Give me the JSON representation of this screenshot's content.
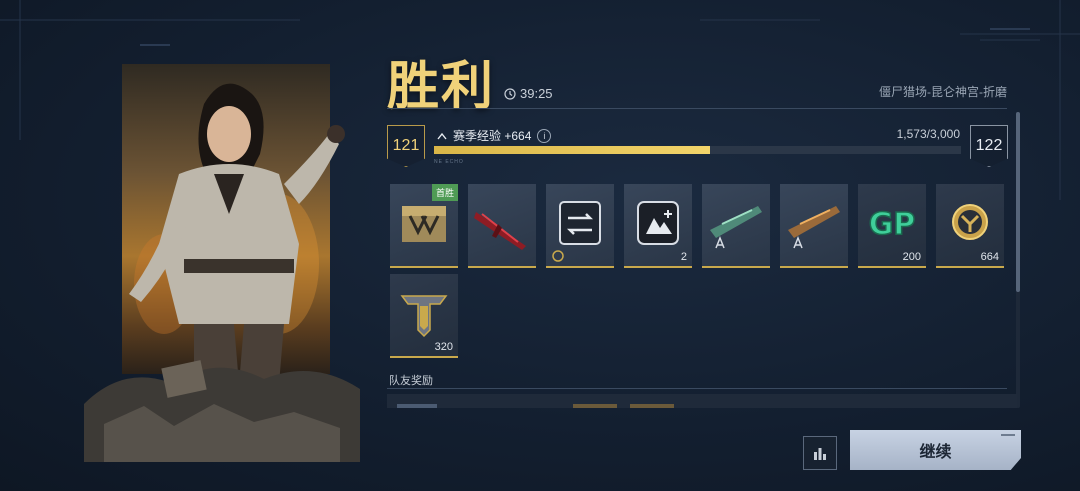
{
  "header": {
    "title": "胜利",
    "timer": "39:25",
    "mode": "僵尸猎场-昆仑神宫-折磨"
  },
  "level": {
    "current": "121",
    "next": "122",
    "xp_label": "赛季经验 +664",
    "xp_progress_text": "1,573/3,000",
    "xp_fraction": 0.524,
    "tiny_caption": "NE ECHO"
  },
  "rewards": [
    {
      "icon": "supply-crate-icon",
      "tag": "首胜",
      "qty": ""
    },
    {
      "icon": "red-weapon-icon",
      "tag": "",
      "qty": ""
    },
    {
      "icon": "weapon-module-icon",
      "tag": "",
      "qty": ""
    },
    {
      "icon": "mountain-booster-icon",
      "tag": "",
      "qty": "2"
    },
    {
      "icon": "green-rifle-blueprint-icon",
      "tag": "",
      "qty": ""
    },
    {
      "icon": "orange-rifle-blueprint-icon",
      "tag": "",
      "qty": ""
    },
    {
      "icon": "gp-currency-icon",
      "tag": "",
      "qty": "200"
    },
    {
      "icon": "gold-token-icon",
      "tag": "",
      "qty": "664"
    },
    {
      "icon": "tier-emblem-icon",
      "tag": "",
      "qty": "320"
    }
  ],
  "team_section": {
    "label": "队友奖励"
  },
  "actions": {
    "continue_label": "继续",
    "stats_icon": "bar-chart-icon"
  },
  "colors": {
    "accent_gold": "#f0d27a",
    "xp_fill": "#d9b648",
    "first_win_tag": "#4f9b55"
  }
}
